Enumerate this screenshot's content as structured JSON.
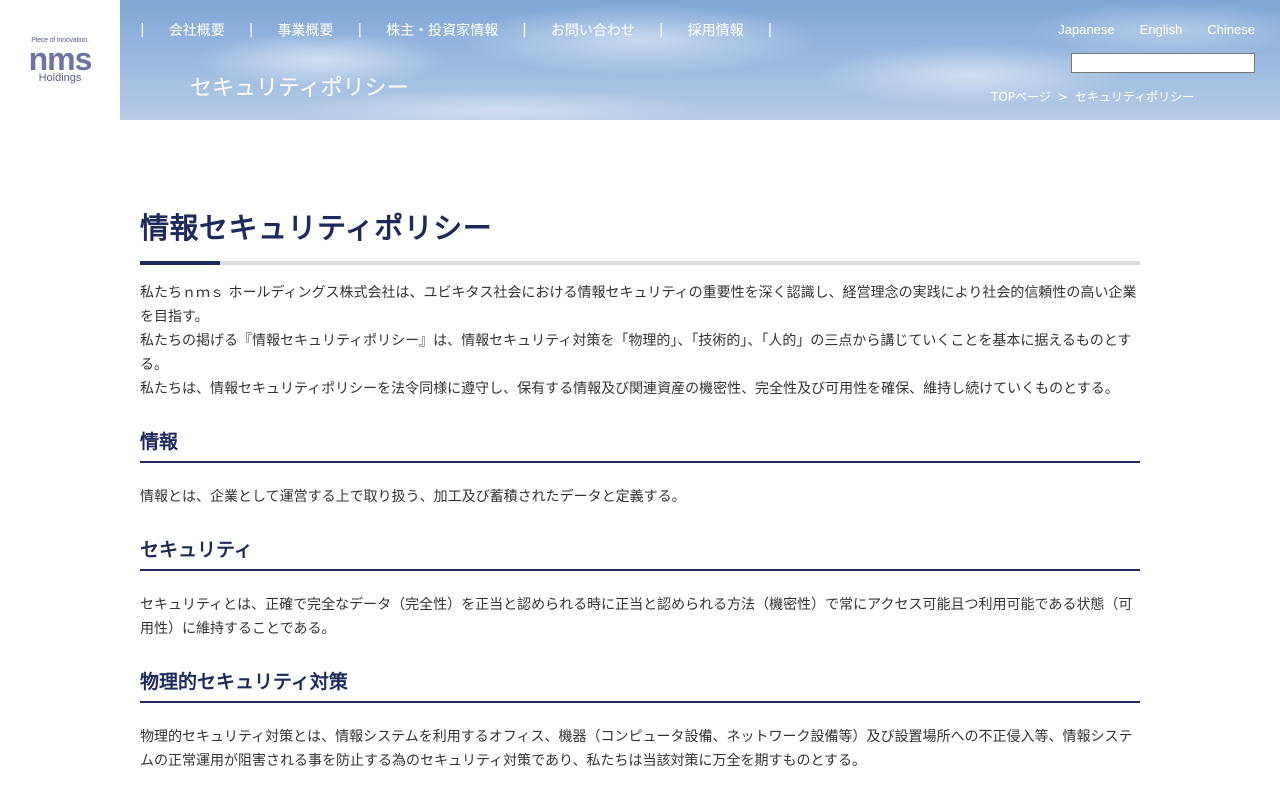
{
  "logo": {
    "tagline": "Piece of Innovation.",
    "main": "nms",
    "sub": "Holdings"
  },
  "nav": {
    "items": [
      "会社概要",
      "事業概要",
      "株主・投資家情報",
      "お問い合わせ",
      "採用情報"
    ]
  },
  "lang": [
    "Japanese",
    "English",
    "Chinese"
  ],
  "search": {
    "value": ""
  },
  "page_heading": "セキュリティポリシー",
  "breadcrumb": {
    "home": "TOPページ",
    "separator": ">",
    "current": "セキュリティポリシー"
  },
  "main": {
    "title": "情報セキュリティポリシー",
    "intro": [
      "私たちｎｍｓ ホールディングス株式会社は、ユビキタス社会における情報セキュリティの重要性を深く認識し、経営理念の実践により社会的信頼性の高い企業を目指す。",
      "私たちの掲げる『情報セキュリティポリシー』は、情報セキュリティ対策を「物理的」、「技術的」、「人的」の三点から講じていくことを基本に据えるものとする。",
      "私たちは、情報セキュリティポリシーを法令同様に遵守し、保有する情報及び関連資産の機密性、完全性及び可用性を確保、維持し続けていくものとする。"
    ],
    "sections": [
      {
        "heading": "情報",
        "body": "情報とは、企業として運営する上で取り扱う、加工及び蓄積されたデータと定義する。"
      },
      {
        "heading": "セキュリティ",
        "body": "セキュリティとは、正確で完全なデータ（完全性）を正当と認められる時に正当と認められる方法（機密性）で常にアクセス可能且つ利用可能である状態（可用性）に維持することである。"
      },
      {
        "heading": "物理的セキュリティ対策",
        "body": "物理的セキュリティ対策とは、情報システムを利用するオフィス、機器（コンピュータ設備、ネットワーク設備等）及び設置場所への不正侵入等、情報システムの正常運用が阻害される事を防止する為のセキュリティ対策であり、私たちは当該対策に万全を期すものとする。"
      }
    ]
  },
  "colors": {
    "navy": "#1e2a5c",
    "sky": "#9ab9e0"
  }
}
